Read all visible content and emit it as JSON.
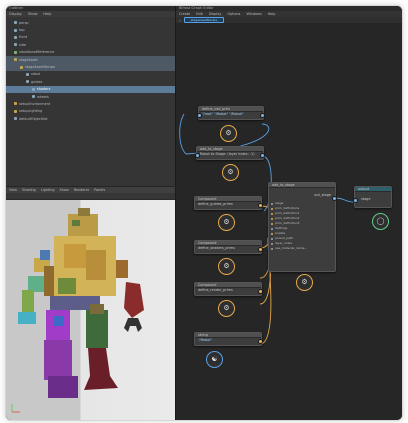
{
  "outliner": {
    "title": "Outliner",
    "menu": [
      "Display",
      "Show",
      "Help"
    ],
    "items": [
      {
        "label": "persp"
      },
      {
        "label": "top"
      },
      {
        "label": "front"
      },
      {
        "label": "side"
      },
      {
        "label": "robotAssetReference"
      },
      {
        "label": "stageAsset"
      },
      {
        "label": "stageAssetRecipe"
      },
      {
        "label": "robot"
      },
      {
        "label": "guides"
      },
      {
        "label": "shaders"
      },
      {
        "label": "wheels"
      },
      {
        "label": "setupEnvironment"
      },
      {
        "label": "setupLighting"
      },
      {
        "label": "defaultObjectSet"
      }
    ]
  },
  "viewport": {
    "menu": [
      "View",
      "Shading",
      "Lighting",
      "Show",
      "Renderer",
      "Panels"
    ]
  },
  "node_editor": {
    "title": "Bifrost Graph Editor",
    "menu": [
      "Create",
      "Edit",
      "Display",
      "Options",
      "Windows",
      "Help"
    ],
    "tab": "stageAssetRecipe",
    "nodes": {
      "root": {
        "title": "define_usd_prim",
        "value": "\"/root\" \"/Robot\" \"/Robot\""
      },
      "prefix": {
        "title": "add_to_stage",
        "value": "Robot to Stage: (layer index: -1)"
      },
      "comp1": {
        "title": "Compound",
        "sub": "define_guides_prims"
      },
      "comp2": {
        "title": "Compound",
        "sub": "define_shaders_prims"
      },
      "comp3": {
        "title": "Compound",
        "sub": "define_render_prims"
      },
      "str": {
        "title": "string",
        "value": "\"/Robot\""
      },
      "stage": {
        "title": "add_to_stage",
        "out": "out_stage",
        "ports": [
          "stage",
          "prim_definitions",
          "prim_definition1",
          "prim_definition2",
          "prim_definition3",
          "Settings",
          "enable",
          "parent_path",
          "layer_index",
          "use_material_name..."
        ]
      },
      "output": {
        "title": "output",
        "port": "stage"
      }
    }
  },
  "colors": {
    "accent_orange": "#e7a94a",
    "accent_blue": "#5aa0e0",
    "accent_green": "#5fce8c",
    "selection": "#5c7c99"
  }
}
